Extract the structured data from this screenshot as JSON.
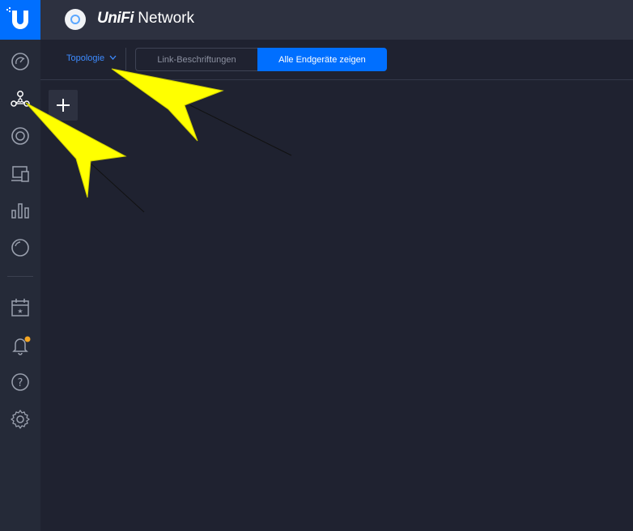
{
  "header": {
    "brand": "UniFi",
    "product": "Network"
  },
  "sidebar": {
    "items": [
      {
        "icon": "dashboard-icon"
      },
      {
        "icon": "topology-icon"
      },
      {
        "icon": "devices-icon"
      },
      {
        "icon": "clients-icon"
      },
      {
        "icon": "statistics-icon"
      },
      {
        "icon": "insights-icon"
      },
      {
        "icon": "events-icon"
      },
      {
        "icon": "alerts-icon"
      },
      {
        "icon": "help-icon"
      },
      {
        "icon": "settings-icon"
      }
    ]
  },
  "toolbar": {
    "view_dropdown": "Topologie",
    "link_labels": "Link-Beschriftungen",
    "show_all_clients": "Alle Endgeräte zeigen"
  },
  "colors": {
    "accent": "#006fff",
    "notification_dot": "#f5a623",
    "annotation_arrow": "#ffff00"
  }
}
